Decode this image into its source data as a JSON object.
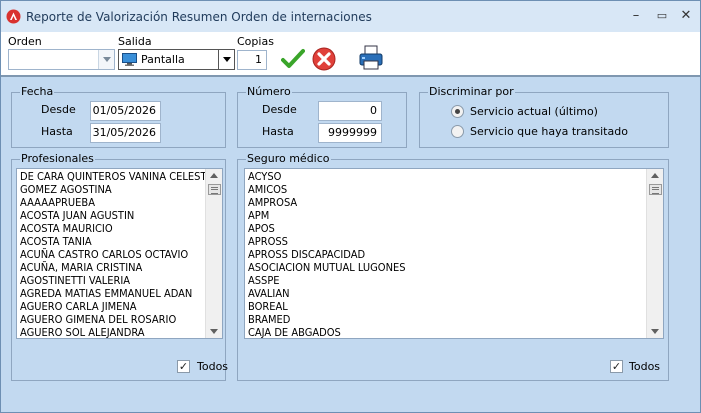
{
  "window": {
    "title": "Reporte de Valorización Resumen Orden de internaciones",
    "minimize_glyph": "–",
    "maximize_glyph": "▭",
    "close_glyph": "✕"
  },
  "toolbar": {
    "orden": {
      "label": "Orden",
      "value": ""
    },
    "salida": {
      "label": "Salida",
      "value": "Pantalla"
    },
    "copias": {
      "label": "Copias",
      "value": "1"
    },
    "accept_icon": "checkmark-icon",
    "cancel_icon": "cancel-icon",
    "print_icon": "printer-icon"
  },
  "fecha": {
    "title": "Fecha",
    "desde_label": "Desde",
    "desde_value": "01/05/2026",
    "hasta_label": "Hasta",
    "hasta_value": "31/05/2026"
  },
  "numero": {
    "title": "Número",
    "desde_label": "Desde",
    "desde_value": "0",
    "hasta_label": "Hasta",
    "hasta_value": "9999999"
  },
  "discriminar": {
    "title": "Discriminar por",
    "options": [
      {
        "label": "Servicio actual (último)",
        "selected": true
      },
      {
        "label": "Servicio que haya transitado",
        "selected": false
      }
    ]
  },
  "profesionales": {
    "title": "Profesionales",
    "items": [
      " DE CARA QUINTEROS VANINA CELESTE",
      " GOMEZ AGOSTINA",
      "AAAAAPRUEBA",
      "ACOSTA JUAN AGUSTIN",
      "ACOSTA MAURICIO",
      "ACOSTA TANIA",
      "ACUÑA CASTRO CARLOS OCTAVIO",
      "ACUÑA, MARIA CRISTINA",
      "AGOSTINETTI VALERIA",
      "AGREDA MATIAS EMMANUEL ADAN",
      "AGUERO CARLA JIMENA",
      "AGUERO GIMENA DEL ROSARIO",
      "AGUERO SOL ALEJANDRA"
    ],
    "todos_label": "Todos",
    "todos_checked": true
  },
  "seguro": {
    "title": "Seguro médico",
    "items": [
      "ACYSO",
      "AMICOS",
      "AMPROSA",
      "APM",
      "APOS",
      "APROSS",
      "APROSS DISCAPACIDAD",
      "ASOCIACION MUTUAL LUGONES",
      "ASSPE",
      "AVALIAN",
      "BOREAL",
      "BRAMED",
      "CAJA DE ABGADOS"
    ],
    "todos_label": "Todos",
    "todos_checked": true
  },
  "colors": {
    "window_bg": "#c2d9f0",
    "titlebar_bg": "#d8e7f6",
    "accept_green": "#3aa52a",
    "cancel_red": "#e0403a",
    "printer_blue": "#2a6fb8"
  }
}
